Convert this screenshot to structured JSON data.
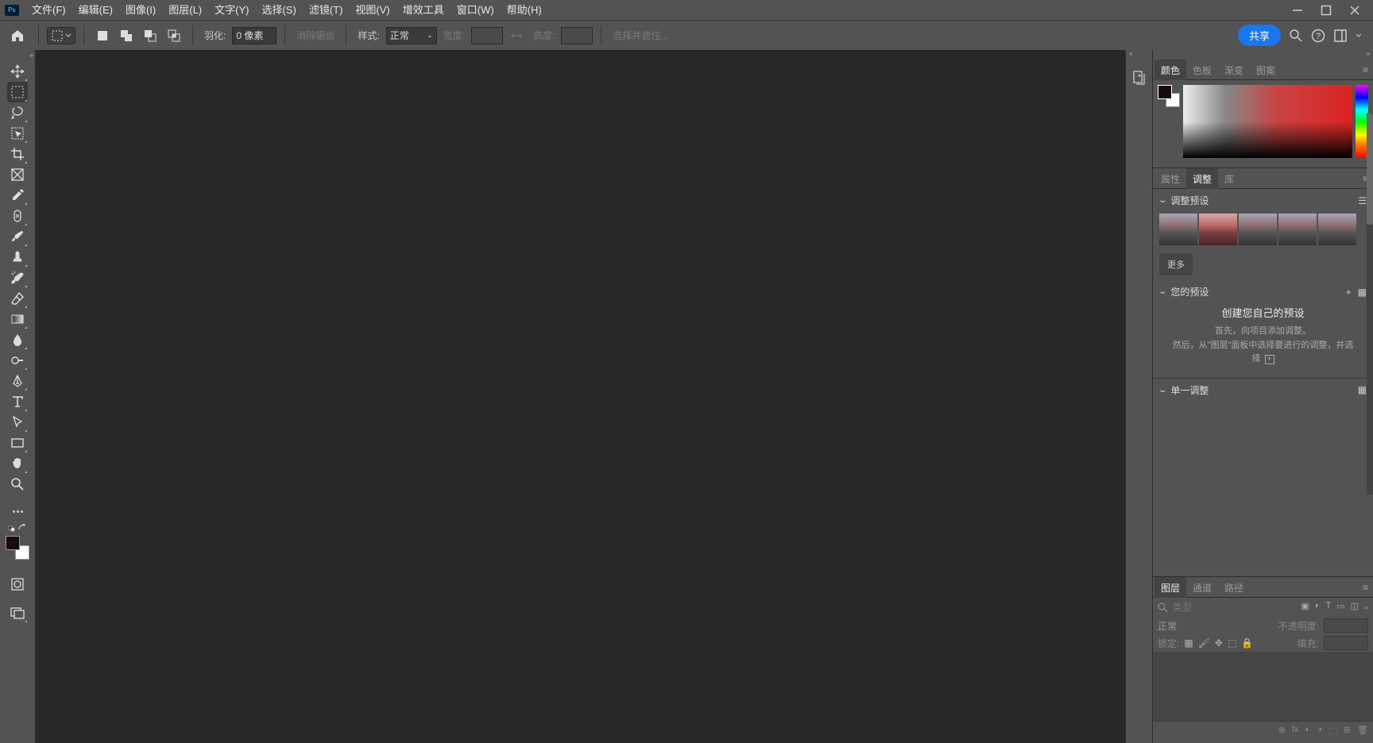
{
  "menubar": {
    "items": [
      "文件(F)",
      "编辑(E)",
      "图像(I)",
      "图层(L)",
      "文字(Y)",
      "选择(S)",
      "滤镜(T)",
      "视图(V)",
      "增效工具",
      "窗口(W)",
      "帮助(H)"
    ]
  },
  "optbar": {
    "feather_label": "羽化:",
    "feather_value": "0 像素",
    "antialias": "消除锯齿",
    "style_label": "样式:",
    "style_value": "正常",
    "width_label": "宽度:",
    "height_label": "高度:",
    "mask_label": "选择并遮住...",
    "share": "共享"
  },
  "panels": {
    "color_tabs": [
      "颜色",
      "色板",
      "渐变",
      "图案"
    ],
    "prop_tabs": [
      "属性",
      "调整",
      "库"
    ],
    "adj_presets": "调整预设",
    "more": "更多",
    "your_presets": "您的预设",
    "create_own": "创建您自己的预设",
    "create_l1": "首先，向项目添加调整。",
    "create_l2": "然后，从\"图层\"面板中选择要进行的调整，并选择",
    "single_adj": "单一调整",
    "layer_tabs": [
      "图层",
      "通道",
      "路径"
    ],
    "search_placeholder": "类型",
    "blend": "正常",
    "opacity_label": "不透明度:",
    "lock_label": "锁定:",
    "fill_label": "填充:"
  },
  "colors": {
    "fg": "#1a0b0b",
    "bg": "#ffffff",
    "share_btn": "#1976ed"
  }
}
